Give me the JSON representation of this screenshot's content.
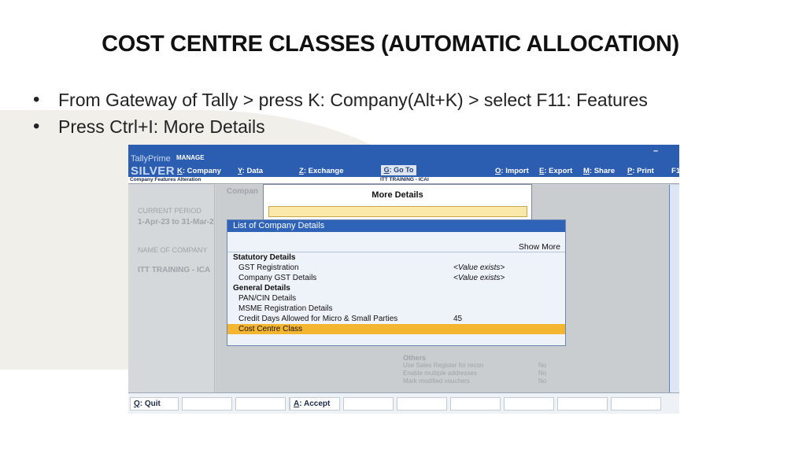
{
  "slide": {
    "title": "COST CENTRE CLASSES (AUTOMATIC ALLOCATION)",
    "bullets": [
      "From Gateway of Tally > press K: Company(Alt+K) > select F11: Features",
      "Press Ctrl+I: More Details"
    ]
  },
  "tally": {
    "brand": "TallyPrime",
    "brand_tag": "MANAGE",
    "edition": "SILVER",
    "menu": [
      {
        "key": "K",
        "label": ": Company"
      },
      {
        "key": "Y",
        "label": ": Data"
      },
      {
        "key": "Z",
        "label": ": Exchange"
      },
      {
        "key": "G",
        "label": ": Go To"
      },
      {
        "key": "O",
        "label": ": Import"
      },
      {
        "key": "E",
        "label": ": Export"
      },
      {
        "key": "M",
        "label": ": Share"
      },
      {
        "key": "P",
        "label": ": Print"
      },
      {
        "key": "F",
        "label": "1"
      }
    ],
    "minimize": "–",
    "screen_name": "Company Features  Alteration",
    "company_name": "ITT TRAINING - ICAI",
    "side": {
      "period_label": "CURRENT PERIOD",
      "period_value": "1-Apr-23 to 31-Mar-2",
      "company_label": "NAME OF COMPANY",
      "company_value": "ITT TRAINING - ICA",
      "panel_label": "Compan"
    },
    "more_details": {
      "title": "More Details",
      "input_value": ""
    },
    "list": {
      "header": "List of Company Details",
      "show_more": "Show More",
      "rows": [
        {
          "label": "Statutory Details",
          "value": "",
          "type": "section"
        },
        {
          "label": "GST Registration",
          "value": "<Value exists>",
          "type": "item"
        },
        {
          "label": "Company GST Details",
          "value": "<Value exists>",
          "type": "item"
        },
        {
          "label": "General Details",
          "value": "",
          "type": "section"
        },
        {
          "label": "PAN/CIN Details",
          "value": "",
          "type": "item"
        },
        {
          "label": "MSME Registration Details",
          "value": "",
          "type": "item"
        },
        {
          "label": "Credit Days Allowed for Micro & Small Parties",
          "value": "45",
          "type": "item"
        },
        {
          "label": "Cost Centre Class",
          "value": "",
          "type": "selected"
        }
      ]
    },
    "others": {
      "heading": "Others",
      "rows": [
        {
          "label": "Use Sales Register for recon",
          "value": "No"
        },
        {
          "label": "Enable multiple addresses",
          "value": "No"
        },
        {
          "label": "Mark modified vouchers",
          "value": "No"
        }
      ]
    },
    "bottom": {
      "quit_key": "Q",
      "quit_label": ": Quit",
      "accept_key": "A",
      "accept_label": ": Accept"
    },
    "colors": {
      "accent": "#2b5db0",
      "selected_row": "#f4b530",
      "input_highlight": "#fbe9a9"
    }
  }
}
